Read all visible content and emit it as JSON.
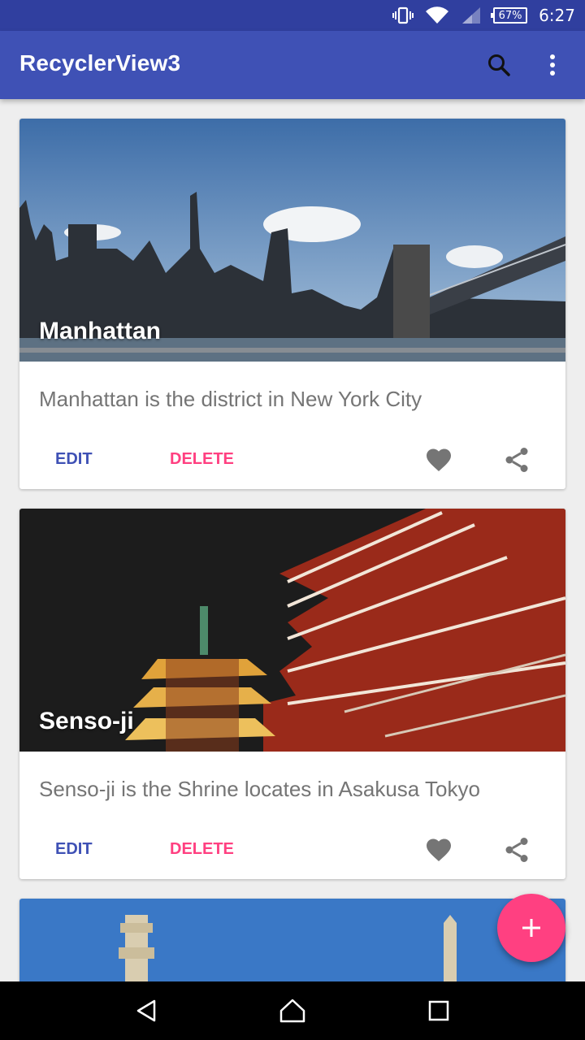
{
  "status_bar": {
    "battery": "67%",
    "time": "6:27"
  },
  "app_bar": {
    "title": "RecyclerView3",
    "search_icon": "search-icon",
    "more_icon": "more-vert-icon",
    "color": "#3f51b5"
  },
  "cards": [
    {
      "title": "Manhattan",
      "description": "Manhattan is the district in New York City",
      "edit_label": "EDIT",
      "delete_label": "DELETE"
    },
    {
      "title": "Senso-ji",
      "description": "Senso-ji is the Shrine locates in Asakusa Tokyo",
      "edit_label": "EDIT",
      "delete_label": "DELETE"
    }
  ],
  "fab": {
    "icon": "add-icon",
    "color": "#ff4081"
  },
  "nav_bar": {
    "back_icon": "back-icon",
    "home_icon": "home-icon",
    "recents_icon": "recents-icon"
  }
}
